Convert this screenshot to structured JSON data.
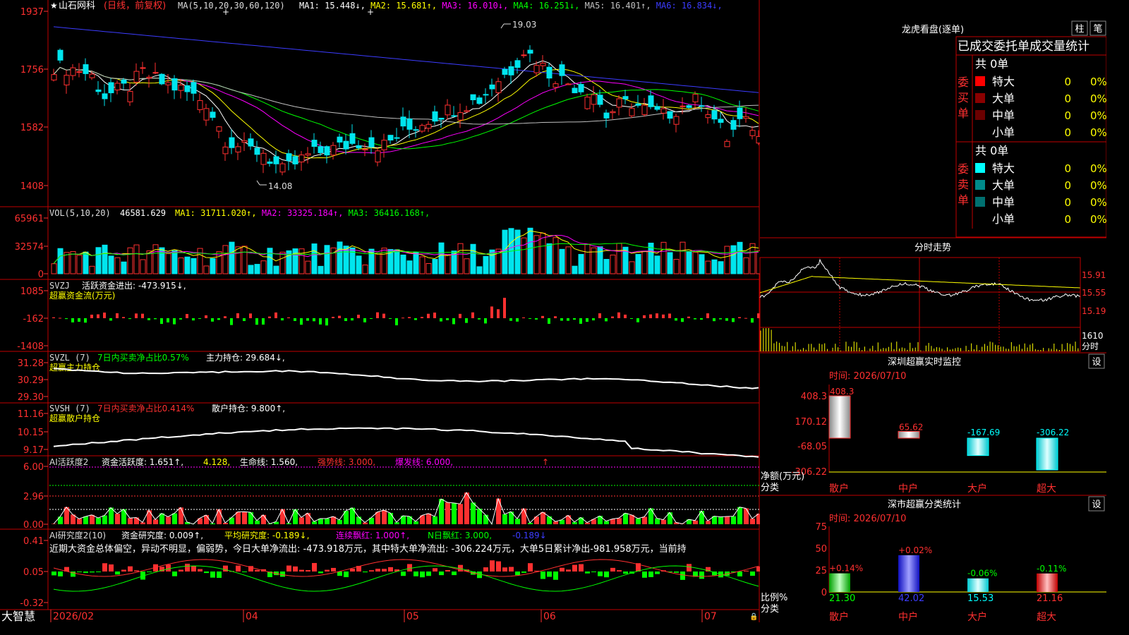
{
  "app": {
    "brand": "大智慧"
  },
  "stock": {
    "name": "山石网科",
    "period": "日线，前复权"
  },
  "colors": {
    "up": "#ff3030",
    "down": "#00e5ee",
    "ma1": "#ffffff",
    "ma2": "#ffff00",
    "ma3": "#ff00ff",
    "ma4": "#00ff00",
    "ma5": "#c0c0c0",
    "ma6": "#3c3cff",
    "grid": "#c00000",
    "panel_title": "#ffffff"
  },
  "main_header": {
    "ma_label": "MA(5,10,20,30,60,120)",
    "items": [
      {
        "label": "MA1:",
        "value": "15.448",
        "arrow": "↓",
        "color": "#ffffff"
      },
      {
        "label": "MA2:",
        "value": "15.681",
        "arrow": "↑",
        "color": "#ffff00"
      },
      {
        "label": "MA3:",
        "value": "16.010",
        "arrow": "↓",
        "color": "#ff00ff"
      },
      {
        "label": "MA4:",
        "value": "16.251",
        "arrow": "↓",
        "color": "#00ff00"
      },
      {
        "label": "MA5:",
        "value": "16.401",
        "arrow": "↑",
        "color": "#c0c0c0"
      },
      {
        "label": "MA6:",
        "value": "16.834",
        "arrow": "↓",
        "color": "#3c3cff"
      }
    ]
  },
  "main_axis": {
    "ticks": [
      "1937",
      "1756",
      "1582",
      "1408"
    ],
    "high_label": "19.03",
    "low_label": "14.08"
  },
  "vol_panel": {
    "title": "VOL(5,10,20)",
    "value": "46581.629",
    "items": [
      {
        "label": "MA1:",
        "value": "31711.020",
        "color": "#ffff00"
      },
      {
        "label": "MA2:",
        "value": "33325.184",
        "color": "#ff00ff"
      },
      {
        "label": "MA3:",
        "value": "36416.168",
        "color": "#00ff00"
      }
    ],
    "ticks": [
      "65961",
      "32574",
      "0"
    ]
  },
  "svzj_panel": {
    "title": "SVZJ",
    "line1": "活跃资金进出: -473.915↓,",
    "line2": "超赢资金流(万元)",
    "ticks": [
      "1085",
      "-162",
      "-1408"
    ]
  },
  "svzl_panel": {
    "title": "SVZL (7)",
    "pct": "7日内买卖净占比0.57%",
    "hold": "主力持仓: 29.684↓,",
    "line2": "超赢主力持仓",
    "ticks": [
      "31.28",
      "30.29",
      "29.30"
    ]
  },
  "svsh_panel": {
    "title": "SVSH (7)",
    "pct": "7日内买卖净占比0.414%",
    "hold": "散户持仓: 9.800↑,",
    "line2": "超赢散户持仓",
    "ticks": [
      "11.16",
      "10.15",
      "9.17"
    ]
  },
  "ai_active": {
    "title": "AI活跃度2",
    "a": "资金活跃度: 1.651↑,",
    "b": "4.128,",
    "c": "生命线: 1.560,",
    "d": "强势线: 3.000,",
    "e": "爆发线: 6.000,",
    "ticks": [
      "6.00",
      "2.96",
      "0.00"
    ]
  },
  "ai_research": {
    "title": "AI研究度2(10)",
    "a": "资金研究度: 0.009↑,",
    "b": "平均研究度: -0.189↓,",
    "c": "连续飘红: 1.000↑,",
    "d": "N日飘红: 3.000,",
    "e": "-0.189↓",
    "commentary": "近期大资金总体偏空，异动不明显，偏弱势，今日大单净流出: -473.918万元，其中特大单净流出: -306.224万元，大单5日累计净出-981.958万元，当前持",
    "ticks": [
      "0.41",
      "0.05",
      "-0.32"
    ]
  },
  "x_axis": {
    "labels": [
      "2026/02",
      "04",
      "05",
      "06",
      "07"
    ]
  },
  "right": {
    "lhb_title": "龙虎看盘(逐单)",
    "tab1": "柱",
    "tab2": "笔",
    "stat_title": "已成交委托单成交量统计",
    "buy_label": "委买单",
    "sell_label": "委卖单",
    "buy_total": "共 0单",
    "sell_total": "共 0单",
    "buy_rows": [
      {
        "name": "特大",
        "count": "0",
        "pct": "0%",
        "color": "#ff0000"
      },
      {
        "name": "大单",
        "count": "0",
        "pct": "0%",
        "color": "#8b0000"
      },
      {
        "name": "中单",
        "count": "0",
        "pct": "0%",
        "color": "#6b0000"
      },
      {
        "name": "小单",
        "count": "0",
        "pct": "0%",
        "color": "#000000"
      }
    ],
    "sell_rows": [
      {
        "name": "特大",
        "count": "0",
        "pct": "0%",
        "color": "#00ffff"
      },
      {
        "name": "大单",
        "count": "0",
        "pct": "0%",
        "color": "#008b8b"
      },
      {
        "name": "中单",
        "count": "0",
        "pct": "0%",
        "color": "#007070"
      },
      {
        "name": "小单",
        "count": "0",
        "pct": "0%",
        "color": "#000000"
      }
    ],
    "intraday_title": "分时走势",
    "intraday_ticks": [
      "15.91",
      "15.55",
      "15.19"
    ],
    "intraday_vol_label": "1610",
    "intraday_vol_unit": "分时",
    "sz_monitor_title": "深圳超赢实时监控",
    "sz_monitor_btn": "设",
    "sz_time": "时间: 2026/07/10",
    "sz_ticks": [
      "408.3",
      "170.12",
      "-68.05",
      "-306.22"
    ],
    "sz_net_label": "净额(万元)",
    "sz_cat_label": "分类",
    "sz_bars": [
      {
        "cat": "散户",
        "value": 408.3,
        "label": "408.3"
      },
      {
        "cat": "中户",
        "value": 65.62,
        "label": "65.62"
      },
      {
        "cat": "大户",
        "value": -167.69,
        "label": "-167.69"
      },
      {
        "cat": "超大",
        "value": -306.22,
        "label": "-306.22"
      }
    ],
    "cls_title": "深市超赢分类统计",
    "cls_btn": "设",
    "cls_time": "时间: 2026/07/10",
    "cls_ticks": [
      "75",
      "50",
      "25",
      "0"
    ],
    "cls_ratio_label": "比例%",
    "cls_cat_label": "分类",
    "cls_bars": [
      {
        "cat": "散户",
        "value": 21.3,
        "label": "21.30",
        "change": "+0.14%"
      },
      {
        "cat": "中户",
        "value": 42.02,
        "label": "42.02",
        "change": "+0.02%"
      },
      {
        "cat": "大户",
        "value": 15.53,
        "label": "15.53",
        "change": "-0.06%"
      },
      {
        "cat": "超大",
        "value": 21.16,
        "label": "21.16",
        "change": "-0.11%"
      }
    ]
  }
}
